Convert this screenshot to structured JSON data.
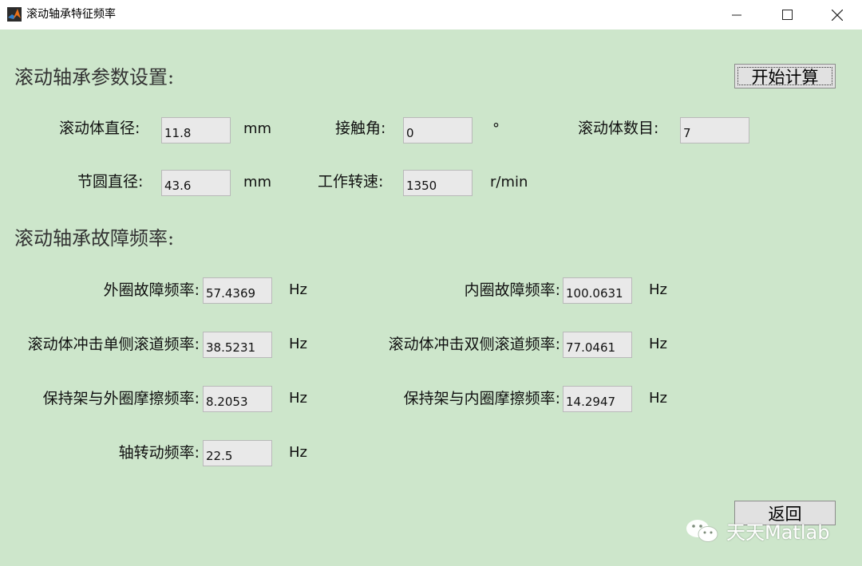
{
  "window": {
    "title": "滚动轴承特征频率",
    "minimize_glyph": "—",
    "maximize_glyph": "☐",
    "close_glyph": "✕"
  },
  "params": {
    "heading": "滚动轴承参数设置:",
    "ball_diameter": {
      "label": "滚动体直径:",
      "value": "11.8",
      "unit": "mm"
    },
    "contact_angle": {
      "label": "接触角:",
      "value": "0",
      "unit": "°"
    },
    "ball_count": {
      "label": "滚动体数目:",
      "value": "7"
    },
    "pitch_diameter": {
      "label": "节圆直径:",
      "value": "43.6",
      "unit": "mm"
    },
    "speed": {
      "label": "工作转速:",
      "value": "1350",
      "unit": "r/min"
    },
    "calc_button": "开始计算"
  },
  "results": {
    "heading": "滚动轴承故障频率:",
    "outer_race": {
      "label": "外圈故障频率:",
      "value": "57.4369",
      "unit": "Hz"
    },
    "inner_race": {
      "label": "内圈故障频率:",
      "value": "100.0631",
      "unit": "Hz"
    },
    "ball_single": {
      "label": "滚动体冲击单侧滚道频率:",
      "value": "38.5231",
      "unit": "Hz"
    },
    "ball_double": {
      "label": "滚动体冲击双侧滚道频率:",
      "value": "77.0461",
      "unit": "Hz"
    },
    "cage_outer": {
      "label": "保持架与外圈摩擦频率:",
      "value": "8.2053",
      "unit": "Hz"
    },
    "cage_inner": {
      "label": "保持架与内圈摩擦频率:",
      "value": "14.2947",
      "unit": "Hz"
    },
    "shaft": {
      "label": "轴转动频率:",
      "value": "22.5",
      "unit": "Hz"
    }
  },
  "back_button": "返回",
  "watermark": "天天Matlab",
  "colors": {
    "background": "#cde6cb",
    "field": "#e9e9e9",
    "button": "#e1e1e1"
  },
  "icons": {
    "app": "matlab-logo-icon",
    "watermark": "wechat-icon"
  }
}
